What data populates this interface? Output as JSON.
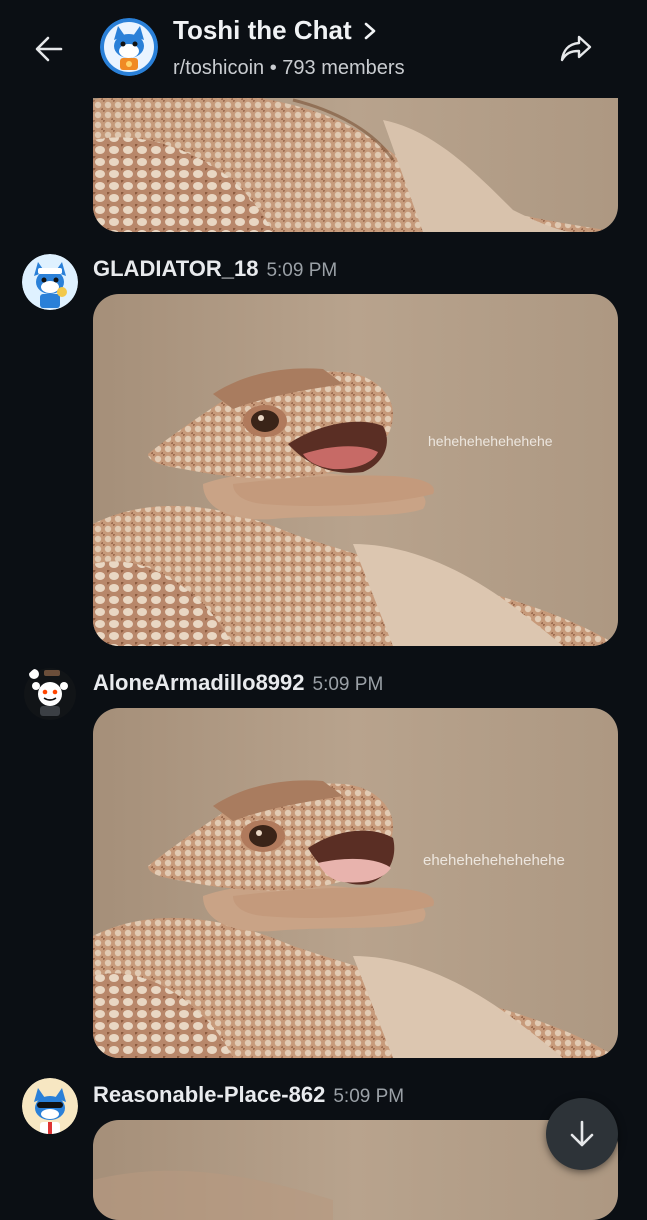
{
  "header": {
    "title": "Toshi the Chat",
    "subreddit": "r/toshicoin",
    "separator": "•",
    "members": "793 members"
  },
  "messages": [
    {
      "username": "GLADIATOR_18",
      "time": "5:09 PM",
      "caption": "hehehehehehehehe"
    },
    {
      "username": "AloneArmadillo8992",
      "time": "5:09 PM",
      "caption": "ehehehehehehehehe"
    },
    {
      "username": "Reasonable-Place-862",
      "time": "5:09 PM"
    }
  ],
  "icons": {
    "back": "arrow-left-icon",
    "share": "share-arrow-icon",
    "chevron": "chevron-right-icon",
    "scroll_down": "arrow-down-icon"
  },
  "colors": {
    "background": "#0b0f14",
    "lizard_bg": "#b39d86",
    "button": "#2d3338"
  }
}
